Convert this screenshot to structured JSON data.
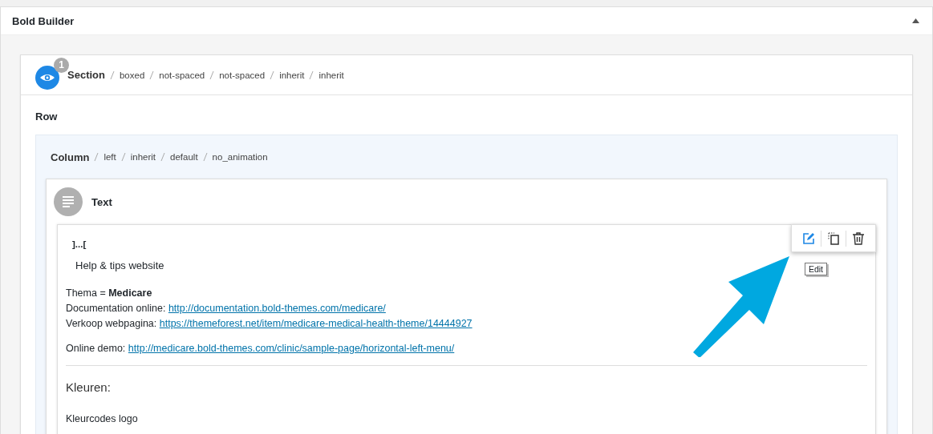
{
  "panel": {
    "title": "Bold Builder",
    "expanded": true
  },
  "section": {
    "badge": "1",
    "label": "Section",
    "params": [
      "boxed",
      "not-spaced",
      "not-spaced",
      "inherit",
      "inherit"
    ]
  },
  "row": {
    "label": "Row"
  },
  "column": {
    "label": "Column",
    "params": [
      "left",
      "inherit",
      "default",
      "no_animation"
    ]
  },
  "element": {
    "title": "Text",
    "toolbar": [
      {
        "kind": "edit",
        "selected": true
      },
      {
        "kind": "clone",
        "selected": false
      },
      {
        "kind": "delete",
        "selected": false
      }
    ],
    "tooltip": "Edit",
    "blocks": [
      {
        "kind": "mark",
        "text": "]...["
      },
      {
        "kind": "lead",
        "text": "Help & tips website"
      },
      {
        "kind": "lines",
        "lines": [
          {
            "text": "Thema = **Medicare**"
          },
          {
            "text": "Documentation online:",
            "link": "http://documentation.bold-themes.com/medicare/"
          },
          {
            "text": "Verkoop webpagina:",
            "link": "https://themeforest.net/item/medicare-medical-health-theme/14444927"
          }
        ]
      },
      {
        "kind": "lines",
        "lines": [
          {
            "text": "Online demo:",
            "link": "http://medicare.bold-themes.com/clinic/sample-page/horizontal-left-menu/"
          }
        ]
      },
      {
        "kind": "rule"
      },
      {
        "kind": "heading",
        "text": "Kleuren:"
      },
      {
        "kind": "para",
        "text": "Kleurcodes logo"
      }
    ]
  }
}
